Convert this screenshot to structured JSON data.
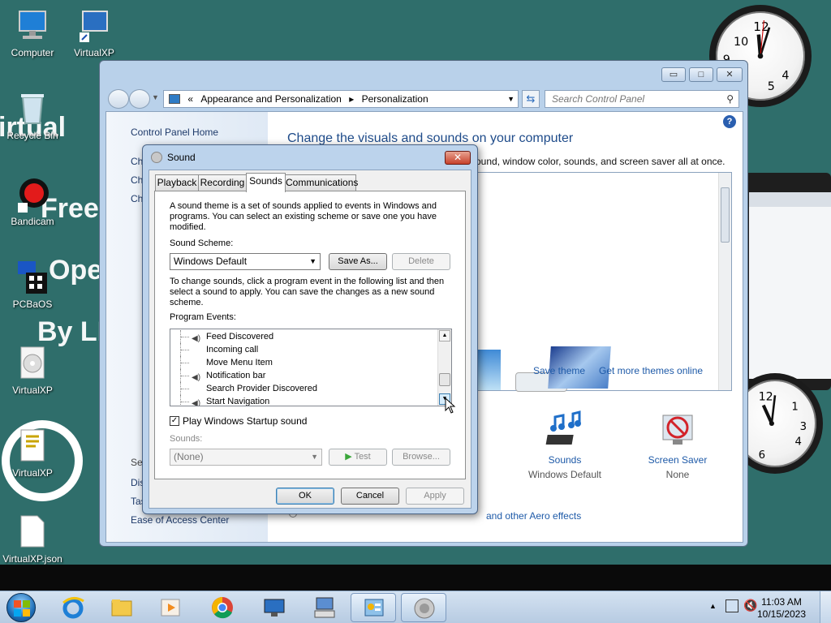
{
  "desktop": {
    "icons": [
      {
        "label": "Computer"
      },
      {
        "label": "VirtualXP"
      },
      {
        "label": "Recycle Bin"
      },
      {
        "label": "Bandicam"
      },
      {
        "label": "PCBaOS"
      },
      {
        "label": "VirtualXP"
      },
      {
        "label": "VirtualXP"
      },
      {
        "label": "VirtualXP.json"
      }
    ],
    "wallpaper_texts": [
      "irtual",
      "Virtu",
      "Free",
      "Oper",
      "By LI"
    ]
  },
  "control_panel": {
    "address": {
      "prefix": "«",
      "segments": [
        "Appearance and Personalization",
        "Personalization"
      ]
    },
    "search_placeholder": "Search Control Panel",
    "left_links": [
      "Control Panel Home",
      "Ch",
      "Ch",
      "Ch"
    ],
    "left_bottom": [
      "See",
      "Dis",
      "Tas",
      "Ease of Access Center"
    ],
    "title": "Change the visuals and sounds on your computer",
    "subtitle": "ound, window color, sounds, and screen saver all at once.",
    "save_theme": "Save theme",
    "get_more_themes": "Get more themes online",
    "bottom": [
      {
        "title": "or",
        "value": "sic"
      },
      {
        "title": "Sounds",
        "value": "Windows Default"
      },
      {
        "title": "Screen Saver",
        "value": "None"
      }
    ],
    "aero_link": "and other Aero effects"
  },
  "sound_dialog": {
    "title": "Sound",
    "tabs": [
      "Playback",
      "Recording",
      "Sounds",
      "Communications"
    ],
    "active_tab": "Sounds",
    "intro": "A sound theme is a set of sounds applied to events in Windows and programs.  You can select an existing scheme or save one you have modified.",
    "scheme_label": "Sound Scheme:",
    "scheme_value": "Windows Default",
    "save_as": "Save As...",
    "delete": "Delete",
    "instructions": "To change sounds, click a program event in the following list and then select a sound to apply.  You can save the changes as a new sound scheme.",
    "events_label": "Program Events:",
    "events": [
      {
        "label": "Feed Discovered",
        "has_sound": true
      },
      {
        "label": "Incoming call",
        "has_sound": false
      },
      {
        "label": "Move Menu Item",
        "has_sound": false
      },
      {
        "label": "Notification bar",
        "has_sound": true
      },
      {
        "label": "Search Provider Discovered",
        "has_sound": false
      },
      {
        "label": "Start Navigation",
        "has_sound": true
      }
    ],
    "startup_checkbox": "Play Windows Startup sound",
    "startup_checked": true,
    "sounds_label": "Sounds:",
    "sounds_value": "(None)",
    "test": "Test",
    "browse": "Browse...",
    "ok": "OK",
    "cancel": "Cancel",
    "apply": "Apply"
  },
  "taskbar": {
    "time": "11:03 AM",
    "date": "10/15/2023"
  }
}
